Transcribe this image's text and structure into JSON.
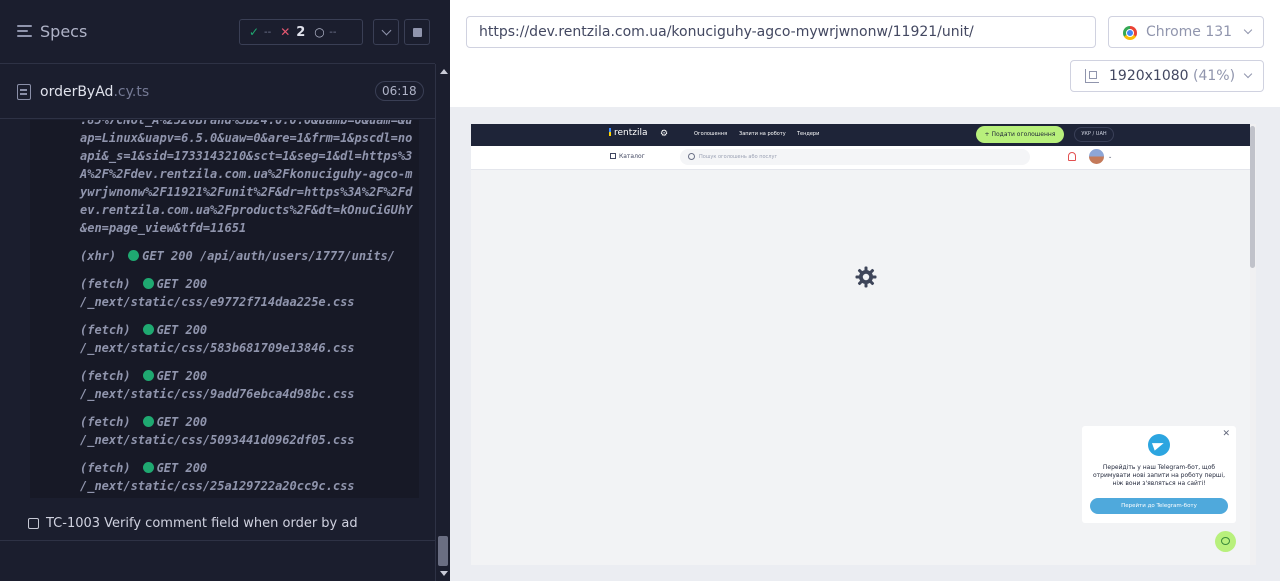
{
  "reporter": {
    "title": "Specs",
    "stats": {
      "passed": "--",
      "failed": "2",
      "pending": "--"
    },
    "spec": {
      "name": "orderByAd",
      "ext": ".cy.ts",
      "duration": "06:18"
    },
    "url_block": ".85%7CNot_A%2520Brand%3B24.0.0.0&uamb=0&uam=&uap=Linux&uapv=6.5.0&uaw=0&are=1&frm=1&pscdl=noapi&_s=1&sid=1733143210&sct=1&seg=1&dl=https%3A%2F%2Fdev.rentzila.com.ua%2Fkonuciguhy-agco-mywrjwnonw%2F11921%2Funit%2F&dr=https%3A%2F%2Fdev.rentzila.com.ua%2Fproducts%2F&dt=kOnuCiGUhY&en=page_view&tfd=11651",
    "logs": [
      {
        "type": "(xhr)",
        "method": "GET 200",
        "path": "/api/auth/users/1777/units/"
      },
      {
        "type": "(fetch)",
        "method": "GET 200",
        "path": "/_next/static/css/e9772f714daa225e.css"
      },
      {
        "type": "(fetch)",
        "method": "GET 200",
        "path": "/_next/static/css/583b681709e13846.css"
      },
      {
        "type": "(fetch)",
        "method": "GET 200",
        "path": "/_next/static/css/9add76ebca4d98bc.css"
      },
      {
        "type": "(fetch)",
        "method": "GET 200",
        "path": "/_next/static/css/5093441d0962df05.css"
      },
      {
        "type": "(fetch)",
        "method": "GET 200",
        "path": "/_next/static/css/25a129722a20cc9c.css"
      }
    ],
    "next_test": "TC-1003 Verify comment field when order by ad"
  },
  "browser": {
    "url": "https://dev.rentzila.com.ua/konuciguhy-agco-mywrjwnonw/11921/unit/",
    "name": "Chrome 131",
    "viewport": "1920x1080",
    "zoom": "(41%)"
  },
  "site": {
    "logo": "rentzila",
    "nav": [
      "Оголошення",
      "Запити на роботу",
      "Тендери"
    ],
    "cta": "Подати оголошення",
    "lang": "УКР / UAH",
    "catalog": "Каталог",
    "search_placeholder": "Пошук оголошень або послуг",
    "telegram_text": "Перейдіть у наш Telegram-бот, щоб отримувати нові запити на роботу перші, ніж вони з'являться на сайті!",
    "telegram_button": "Перейти до Telegram-боту"
  },
  "colors": {
    "passed": "#1fa971",
    "failed": "#e45770",
    "accent": "#b8f07c"
  }
}
